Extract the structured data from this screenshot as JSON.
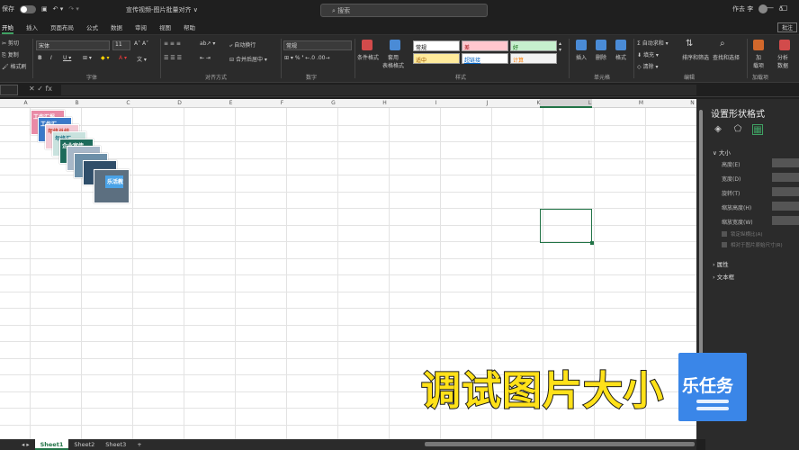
{
  "titlebar": {
    "autosave": "保存",
    "title": "宣传视频-图片批量对齐 ∨",
    "search_placeholder": "搜索",
    "user": "作去 李"
  },
  "menu": {
    "items": [
      "开始",
      "插入",
      "页面布局",
      "公式",
      "数据",
      "审阅",
      "视图",
      "帮助"
    ],
    "comment": "批注"
  },
  "ribbon": {
    "clipboard": {
      "cut": "剪切",
      "copy": "复制",
      "format_painter": "格式刷"
    },
    "font": {
      "name": "宋体",
      "size": "11",
      "label": "字体"
    },
    "alignment": {
      "wrap": "自动换行",
      "merge": "合并后居中",
      "label": "对齐方式"
    },
    "number": {
      "format": "常规",
      "label": "数字"
    },
    "styles": {
      "conditional": "条件格式",
      "table": "套用\n表格格式",
      "label": "样式",
      "cells": [
        "常规",
        "差",
        "好",
        "适中",
        "超链接",
        "计算"
      ]
    },
    "cells_group": {
      "insert": "插入",
      "delete": "删除",
      "format": "格式",
      "label": "单元格"
    },
    "editing": {
      "autosum": "自动求和",
      "fill": "填充",
      "clear": "清除",
      "sort": "排序和筛选",
      "find": "查找和选择",
      "label": "编辑"
    },
    "addins": {
      "addin": "加\n载项",
      "analyze": "分析\n数据",
      "label": "加载项"
    }
  },
  "columns": [
    "A",
    "B",
    "C",
    "D",
    "E",
    "F",
    "G",
    "H",
    "I",
    "J",
    "K",
    "L",
    "M",
    "N"
  ],
  "thumbnails": [
    {
      "text": "工作汇报"
    },
    {
      "text": "工作汇"
    },
    {
      "text": "年终总结"
    },
    {
      "text": "年终汇"
    },
    {
      "text": "企业宣传"
    },
    {
      "text": ""
    },
    {
      "text": ""
    },
    {
      "text": ""
    },
    {
      "text": "乐活教"
    }
  ],
  "sheets": [
    "Sheet1",
    "Sheet2",
    "Sheet3"
  ],
  "panel": {
    "title": "设置形状格式",
    "size_section": "大小",
    "rows": [
      "高度(E)",
      "宽度(D)",
      "旋转(T)",
      "缩放高度(H)",
      "缩放宽度(W)"
    ],
    "checks": [
      "锁定纵横比(A)",
      "相对于图片原始尺寸(R)"
    ],
    "property": "属性",
    "textbox": "文本框"
  },
  "overlay": {
    "caption": "调试图片大小",
    "logo": "乐任务"
  },
  "colors": {
    "accent": "#217346",
    "caption": "#ffe119",
    "logo_bg": "#3a86e8"
  }
}
